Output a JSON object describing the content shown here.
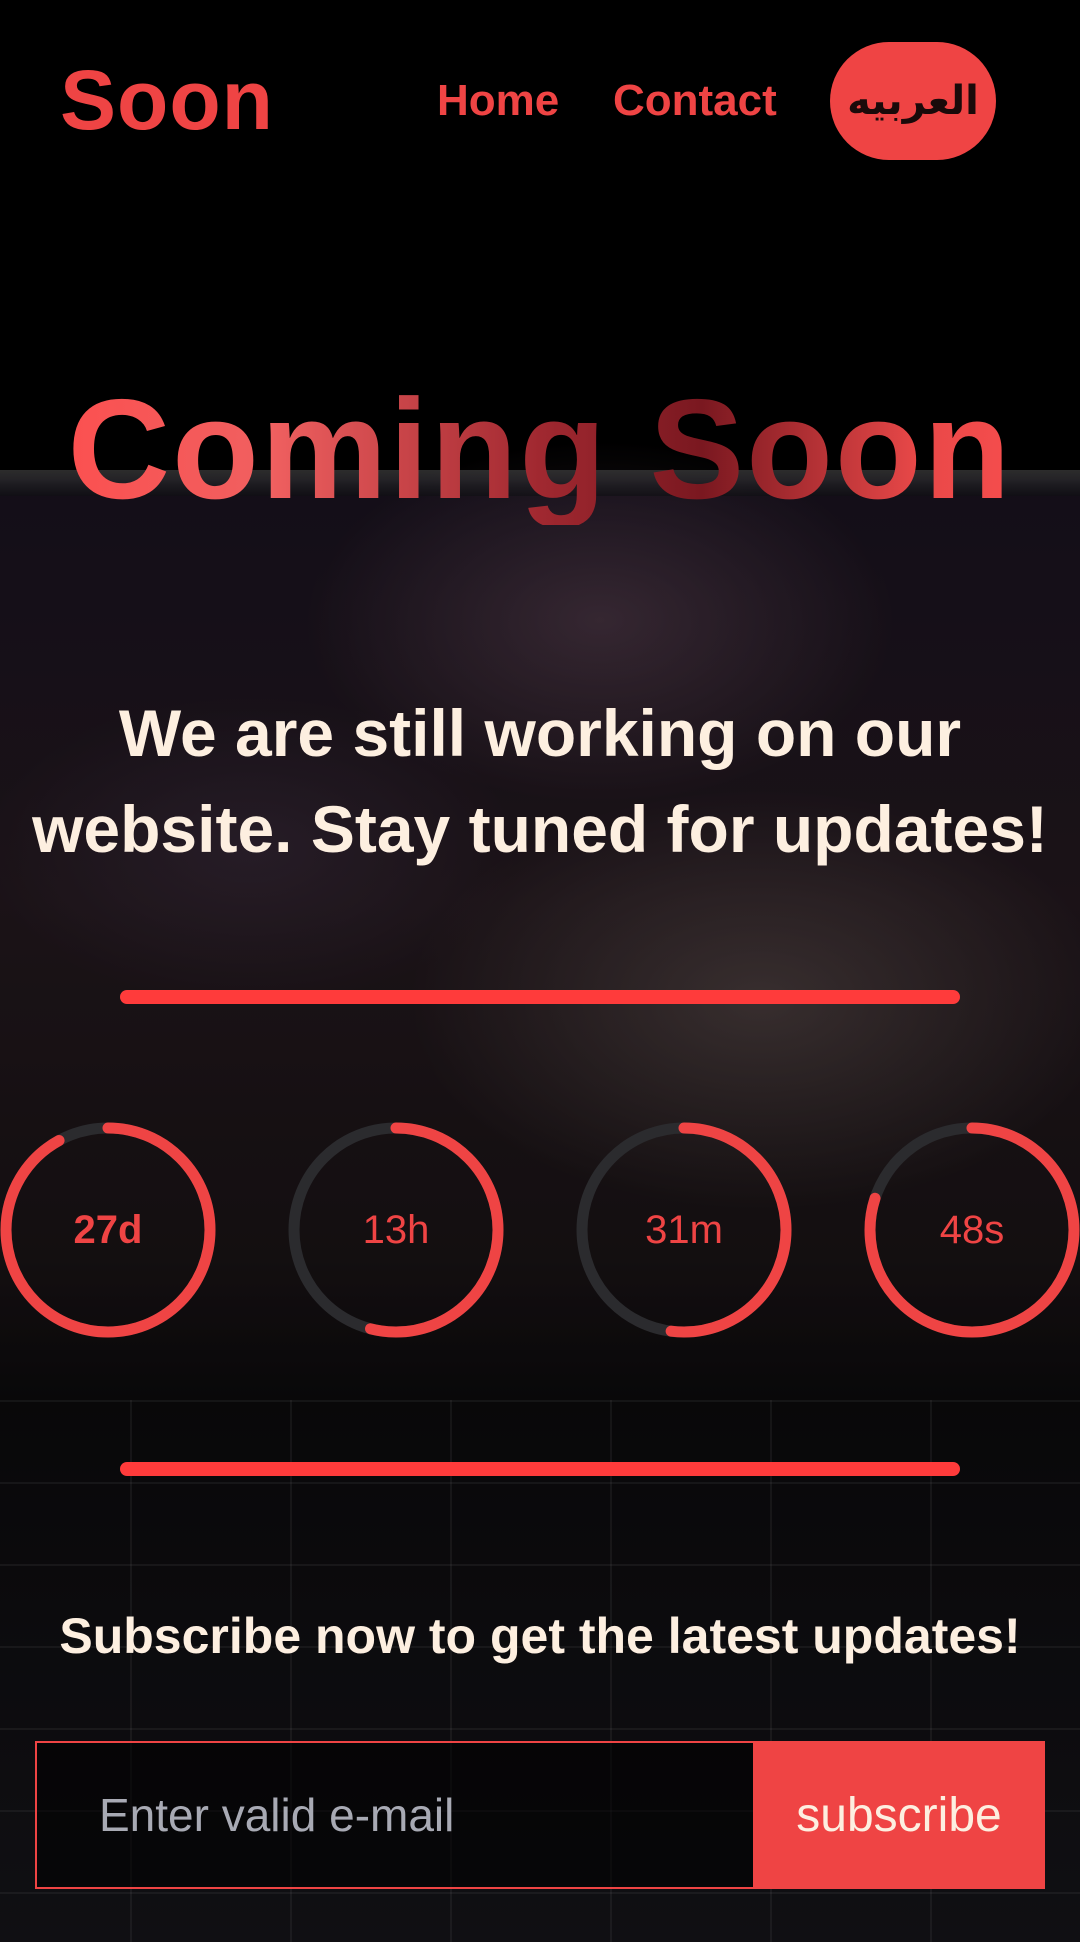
{
  "header": {
    "logo": "Soon",
    "nav": {
      "home": "Home",
      "contact": "Contact"
    },
    "language_button": "العربيه"
  },
  "hero": {
    "title": "Coming Soon",
    "subtitle": "We are still working on our website. Stay tuned for updates!"
  },
  "countdown": [
    {
      "label": "27d",
      "progress": 0.92
    },
    {
      "label": "13h",
      "progress": 0.54
    },
    {
      "label": "31m",
      "progress": 0.52
    },
    {
      "label": "48s",
      "progress": 0.8
    }
  ],
  "subscribe": {
    "heading": "Subscribe now to get the latest updates!",
    "email_placeholder": "Enter valid e-mail",
    "button_label": "subscribe"
  },
  "colors": {
    "accent": "#ef4444",
    "text_light": "#fdefe0",
    "ring_track": "#2b2b2e"
  }
}
